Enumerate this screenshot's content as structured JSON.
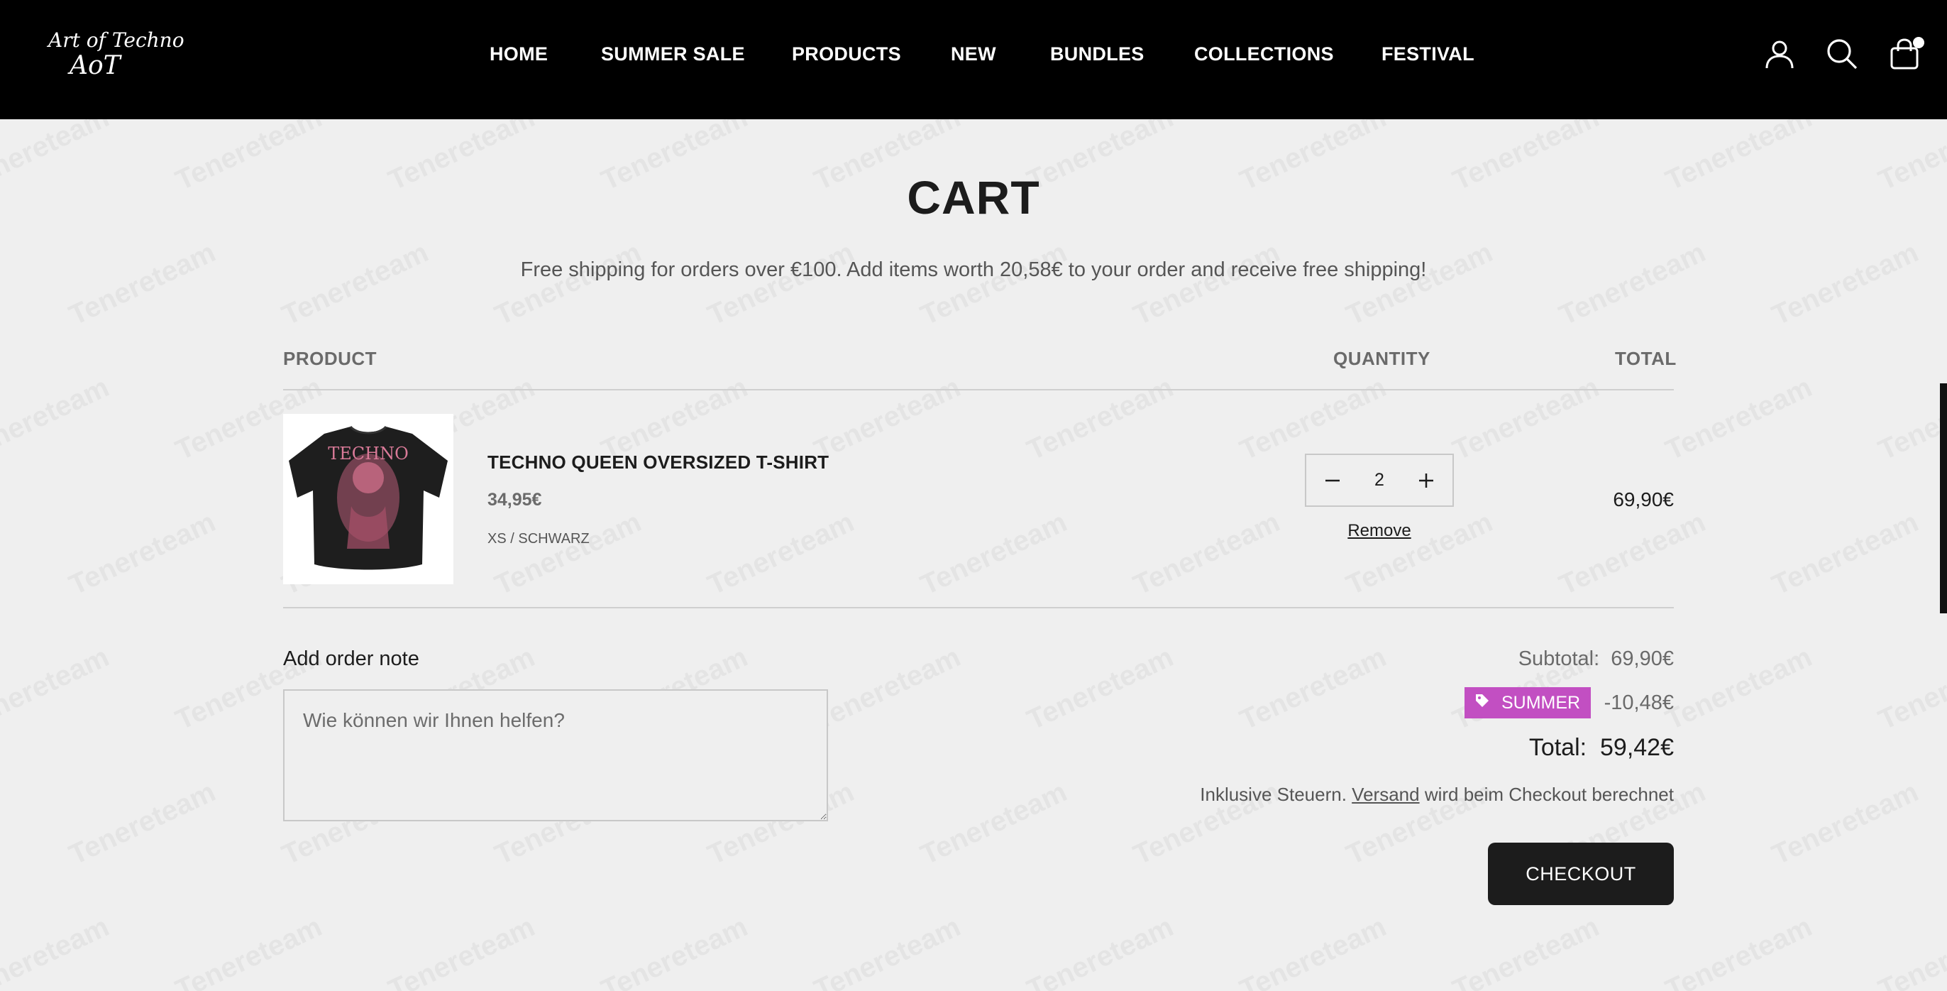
{
  "header": {
    "logo_text": "Art of Techno",
    "logo_mark": "AoT",
    "nav": [
      "HOME",
      "SUMMER SALE",
      "PRODUCTS",
      "NEW",
      "BUNDLES",
      "COLLECTIONS",
      "FESTIVAL"
    ],
    "icons": [
      "user-icon",
      "search-icon",
      "shopping-bag-icon"
    ]
  },
  "watermark": "Tenereteam",
  "cart": {
    "title": "CART",
    "shipping_message": "Free shipping for orders over €100. Add items worth 20,58€ to your order and receive free shipping!",
    "columns": {
      "product": "PRODUCT",
      "quantity": "QUANTITY",
      "total": "TOTAL"
    },
    "item": {
      "image_text": "TECHNO",
      "name": "TECHNO QUEEN OVERSIZED T-SHIRT",
      "price": "34,95€",
      "variant": "XS / SCHWARZ",
      "quantity": "2",
      "remove_label": "Remove",
      "line_total": "69,90€"
    },
    "note": {
      "label": "Add order note",
      "placeholder": "Wie können wir Ihnen helfen?"
    },
    "summary": {
      "subtotal_label": "Subtotal:",
      "subtotal_value": "69,90€",
      "discount_code": "SUMMER",
      "discount_value": "-10,48€",
      "total_label": "Total:",
      "total_value": "59,42€",
      "tax_prefix": "Inklusive Steuern.",
      "tax_link": "Versand",
      "tax_suffix": "wird beim Checkout berechnet"
    },
    "checkout_label": "CHECKOUT"
  },
  "colors": {
    "header_bg": "#000000",
    "page_bg": "#efefef",
    "discount_badge": "#c24fc2",
    "checkout_bg": "#1c1c1c"
  }
}
